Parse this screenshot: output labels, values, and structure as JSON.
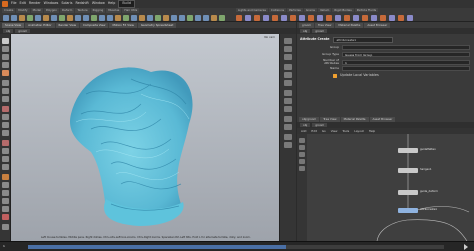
{
  "app": {
    "menubar": [
      "File",
      "Edit",
      "Render",
      "Windows",
      "Solaris",
      "Redshift",
      "Window",
      "Help"
    ],
    "desktop": "Build"
  },
  "shelf": {
    "tabs": [
      "Create",
      "Modify",
      "Model",
      "Polygon",
      "Deform",
      "Texture",
      "Rigging",
      "Muscles",
      "Hair Utils",
      "Guide Process",
      "Guide Brushes",
      "Terrain FX",
      "Simple FX"
    ],
    "right_tabs": [
      "Lights and Cameras",
      "Collisions",
      "Particles",
      "Grains",
      "Vellum",
      "Rigid Bodies",
      "Particle Fluids",
      "Viscous Fluids",
      "Oceans",
      "Pyro FX"
    ]
  },
  "viewport": {
    "tabs": [
      "Scene View",
      "Animation Editor",
      "Render View",
      "Composite View",
      "Motion FX View",
      "Geometry Spreadsheet"
    ],
    "path": [
      "obj",
      "groom"
    ],
    "camera": "No cam",
    "hint": "Left mouse tumbles. Middle pans. Right dollies. Ctrl+Alt+Left box-zooms. Ctrl+Right zooms. Spacebar-Ctrl-Left tilts. Hold L for alternate tumble, dolly, and zoom."
  },
  "timeline": {
    "frame": "1",
    "progress": 0.62
  },
  "param": {
    "tabs": [
      "groom",
      "Tree View",
      "Material Palette",
      "Asset Browser"
    ],
    "path": [
      "obj",
      "groom"
    ],
    "node_type": "Attribute Create",
    "node_name": "attribcreate1",
    "rows": [
      {
        "label": "Group",
        "value": ""
      },
      {
        "label": "Group Type",
        "value": "Guess from Group"
      },
      {
        "label": "Number of Attributes",
        "value": "1"
      },
      {
        "label": "Name",
        "value": ""
      }
    ],
    "checkbox_label": "Update Local Variables"
  },
  "network": {
    "tabs": [
      "obj/groom",
      "Tree View",
      "Material Palette",
      "Asset Browser"
    ],
    "path": [
      "obj",
      "groom"
    ],
    "menu": [
      "Add",
      "Edit",
      "Go",
      "View",
      "Tools",
      "Layout",
      "Help"
    ],
    "nodes": [
      {
        "name": "guideflatten",
        "display": false
      },
      {
        "name": "hairgen1",
        "display": false
      },
      {
        "name": "guide_deform",
        "display": false
      },
      {
        "name": "attribcreate1",
        "display": true
      }
    ]
  }
}
